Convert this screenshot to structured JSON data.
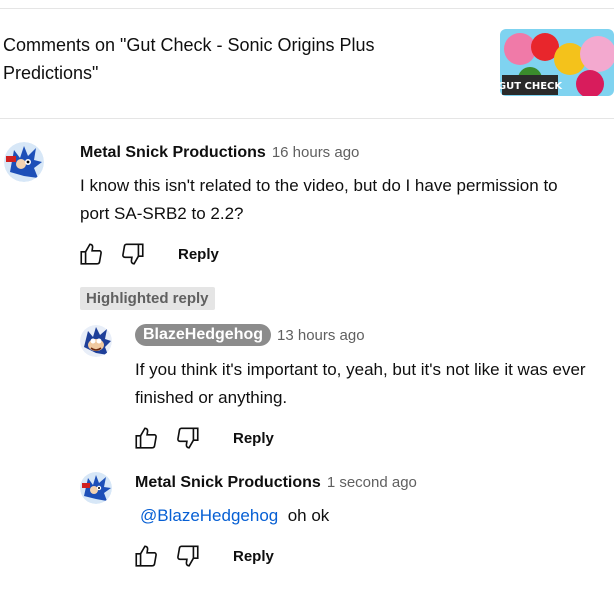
{
  "header": {
    "title": "Comments on \"Gut Check - Sonic Origins Plus Predictions\"",
    "thumbnail_text": "GUT CHECK"
  },
  "comments": [
    {
      "author": "Metal Snick Productions",
      "time": "16 hours ago",
      "text": "I know this isn't related to the video, but do I have permission to port SA-SRB2 to 2.2?",
      "reply_label": "Reply"
    }
  ],
  "highlighted_label": "Highlighted reply",
  "replies": [
    {
      "author": "BlazeHedgehog",
      "time": "13 hours ago",
      "text": "If you think it's important to, yeah, but it's not like it was ever finished or anything.",
      "reply_label": "Reply"
    },
    {
      "author": "Metal Snick Productions",
      "time": "1 second ago",
      "mention": "@BlazeHedgehog",
      "text": "oh ok",
      "reply_label": "Reply"
    }
  ],
  "icons": {
    "like": "thumbs-up-icon",
    "dislike": "thumbs-down-icon"
  },
  "colors": {
    "link": "#065fd4",
    "secondary_text": "#606060",
    "creator_chip": "#8c8c8c",
    "badge_bg": "#e5e5e5"
  }
}
